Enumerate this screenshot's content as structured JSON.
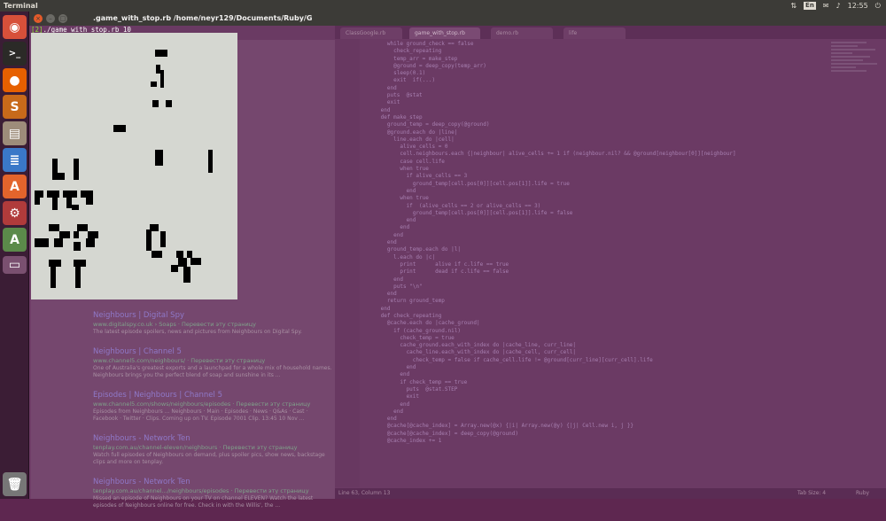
{
  "topbar": {
    "app_name": "Terminal",
    "lang": "En",
    "clock": "12:55"
  },
  "terminal": {
    "path": ".game_with_stop.rb  /home/neyr129/Documents/Ruby/G",
    "prompt": "[2]",
    "command": "./game_with_stop.rb 10",
    "close_icon": "×",
    "min_icon": "–",
    "max_icon": "□"
  },
  "browser": {
    "results": [
      {
        "title": "Neighbours | Digital Spy",
        "url": "www.digitalspy.co.uk › Soaps · Перевести эту страницу",
        "desc": "The latest episode spoilers, news and pictures from Neighbours on Digital Spy."
      },
      {
        "title": "Neighbours | Channel 5",
        "url": "www.channel5.com/neighbours/ · Перевести эту страницу",
        "desc": "One of Australia's greatest exports and a launchpad for a whole mix of household names. Neighbours brings you the perfect blend of soap and sunshine in its ..."
      },
      {
        "title": "Episodes | Neighbours | Channel 5",
        "url": "www.channel5.com/shows/neighbours/episodes · Перевести эту страницу",
        "desc": "Episodes from Neighbours ... Neighbours · Main · Episodes · News · Q&As · Cast · Facebook · Twitter · Clips. Coming up on TV. Episode 7001 Clip. 13:45 10 Nov ..."
      },
      {
        "title": "Neighbours - Network Ten",
        "url": "tenplay.com.au/channel-eleven/neighbours · Перевести эту страницу",
        "desc": "Watch full episodes of Neighbours on demand, plus spoiler pics, show news, backstage clips and more on tenplay."
      },
      {
        "title": "Neighbours - Network Ten",
        "url": "tenplay.com.au/channel.../neighbours/episodes · Перевести эту страницу",
        "desc": "Missed an episode of Neighbours on your TV on channel ELEVEN? Watch the latest episodes of Neighbours online for free. Check in with the Willis', the ..."
      }
    ]
  },
  "editor": {
    "tabs": [
      "ClassGoogle.rb",
      "game_with_stop.rb",
      "demo.rb",
      "life"
    ],
    "code_lines": [
      "        while ground_check == false",
      "          check_repeating",
      "          temp_arr = make_step",
      "          @ground = deep_copy(temp_arr)",
      "          sleep(0.1)",
      "          exit  if(...)",
      "        end",
      "        puts  @stat",
      "        exit",
      "      end",
      "",
      "      def make_step",
      "        ground_temp = deep_copy(@ground)",
      "        @ground.each do |line|",
      "          line.each do |cell|",
      "            alive_cells = 0",
      "            cell.neighbours.each {|neighbour| alive_cells += 1 if (neighbour.nil? && @ground[neighbour[0]][neighbour]",
      "            case cell.life",
      "            when true",
      "              if alive_cells == 3",
      "                ground_temp[cell.pos[0]][cell.pos[1]].life = true",
      "              end",
      "            when true",
      "              if  (alive_cells == 2 or alive_cells == 3)",
      "                ground_temp[cell.pos[0]][cell.pos[1]].life = false",
      "              end",
      "            end",
      "          end",
      "        end",
      "        ground_temp.each do |l|",
      "          l.each do |c|",
      "            print      alive if c.life == true",
      "            print      dead if c.life == false",
      "          end",
      "          puts \"\\n\"",
      "        end",
      "        return ground_temp",
      "      end",
      "",
      "      def check_repeating",
      "        @cache.each do |cache_ground|",
      "          if (cache_ground.nil)",
      "            check_temp = true",
      "            cache_ground.each_with_index do |cache_line, curr_line|",
      "              cache_line.each_with_index do |cache_cell, curr_cell|",
      "                check_temp = false if cache_cell.life != @ground[curr_line][curr_cell].life",
      "              end",
      "            end",
      "            if check_temp == true",
      "              puts  @stat.STEP",
      "              exit",
      "            end",
      "          end",
      "        end",
      "        @cache[@cache_index] = Array.new(@x) {|i| Array.new(@y) {|j| Cell.new i, j }}",
      "        @cache[@cache_index] = deep_copy(@ground)",
      "        @cache_index += 1"
    ],
    "status_left": "Line 63, Column 13",
    "status_mid": "Tab Size: 4",
    "status_right": "Ruby"
  },
  "colors": {
    "desktop": "#5e2750",
    "panel": "#3c3b37",
    "game_bg": "#d5d7d1",
    "cell": "#000000",
    "prompt": "#8ae234"
  }
}
